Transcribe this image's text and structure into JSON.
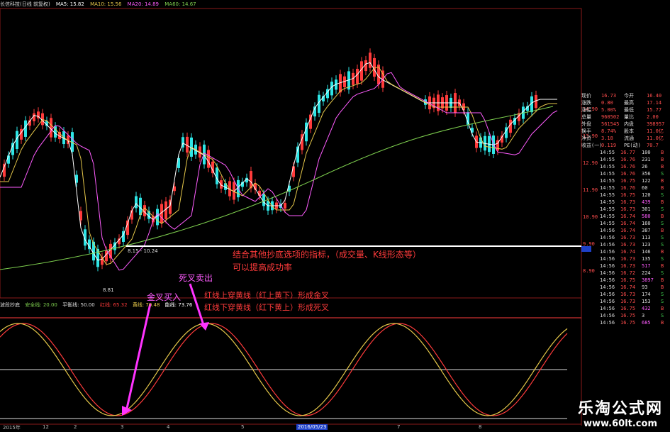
{
  "topbar": {
    "title": "长信科技(日线 前复权)",
    "ma5": "MA5: 15.82",
    "ma10": "MA10: 15.56",
    "ma20": "MA20: 14.89",
    "ma60": "MA60: 14.67"
  },
  "annotations": {
    "combine_line1": "结合其他抄底选项的指标，（成交量、K线形态等）",
    "combine_line2": "可以提高成功率",
    "golden_cross": "金叉买入",
    "dead_cross": "死叉卖出",
    "rule1": "红线上穿黄线（红上黄下）形成金叉",
    "rule2": "红线下穿黄线（红下黄上）形成死叉"
  },
  "price_labels": {
    "low": "8.81",
    "mid": "8.15 - 10.24"
  },
  "indicator_header": {
    "name": "波段抄底",
    "safe": "安全线: 20.00",
    "balance": "平衡线: 50.00",
    "red": "红线: 65.32",
    "yellow": "黄线: 70.48",
    "energy": "能线: 73.76"
  },
  "right_axis": [
    "14.90",
    "13.90",
    "12.90",
    "11.90",
    "10.90",
    "9.90",
    "8.90"
  ],
  "bottom_axis": {
    "year": "2015年",
    "m12": "12",
    "m2": "2",
    "m3": "3",
    "m4": "4",
    "m5": "5",
    "date": "2016/05/23",
    "m7": "7",
    "m8": "8"
  },
  "quote": [
    {
      "k": "现价",
      "v": "16.73",
      "k2": "今开",
      "v2": "16.40"
    },
    {
      "k": "涨跌",
      "v": "0.80",
      "k2": "最高",
      "v2": "17.14"
    },
    {
      "k": "涨幅",
      "v": "5.00%",
      "k2": "最低",
      "v2": "15.77"
    },
    {
      "k": "总量",
      "v": "960502",
      "k2": "量比",
      "v2": "2.00"
    },
    {
      "k": "外盘",
      "v": "561545",
      "k2": "内盘",
      "v2": "398957"
    },
    {
      "k": "换手",
      "v": "8.74%",
      "k2": "股本",
      "v2": "11.0亿"
    },
    {
      "k": "净资",
      "v": "3.18",
      "k2": "流通",
      "v2": "11.0亿"
    },
    {
      "k": "收益(一)",
      "v": "0.119",
      "k2": "PE(动)",
      "v2": "70.7"
    }
  ],
  "ticks": [
    {
      "t": "14:55",
      "p": "16.77",
      "q": "100",
      "s": "B"
    },
    {
      "t": "14:55",
      "p": "16.76",
      "q": "231",
      "s": "B"
    },
    {
      "t": "14:55",
      "p": "16.76",
      "q": "26",
      "s": "B"
    },
    {
      "t": "14:55",
      "p": "16.76",
      "q": "356",
      "s": "S"
    },
    {
      "t": "14:55",
      "p": "16.75",
      "q": "122",
      "s": "B"
    },
    {
      "t": "14:55",
      "p": "16.76",
      "q": "60",
      "s": "B"
    },
    {
      "t": "14:55",
      "p": "16.75",
      "q": "120",
      "s": "S"
    },
    {
      "t": "14:55",
      "p": "16.73",
      "q": "439",
      "s": "B"
    },
    {
      "t": "14:55",
      "p": "16.73",
      "q": "301",
      "s": "S"
    },
    {
      "t": "14:55",
      "p": "16.74",
      "q": "580",
      "s": "B"
    },
    {
      "t": "14:55",
      "p": "16.74",
      "q": "160",
      "s": "S"
    },
    {
      "t": "14:56",
      "p": "16.74",
      "q": "387",
      "s": "B"
    },
    {
      "t": "14:56",
      "p": "16.73",
      "q": "113",
      "s": "S"
    },
    {
      "t": "14:56",
      "p": "16.73",
      "q": "123",
      "s": "S"
    },
    {
      "t": "14:56",
      "p": "16.74",
      "q": "146",
      "s": "B"
    },
    {
      "t": "14:56",
      "p": "16.73",
      "q": "135",
      "s": "S"
    },
    {
      "t": "14:56",
      "p": "16.73",
      "q": "517",
      "s": "B"
    },
    {
      "t": "14:56",
      "p": "16.72",
      "q": "224",
      "s": "S"
    },
    {
      "t": "14:56",
      "p": "16.75",
      "q": "3897",
      "s": "B"
    },
    {
      "t": "14:56",
      "p": "16.74",
      "q": "93",
      "s": "B"
    },
    {
      "t": "14:56",
      "p": "16.73",
      "q": "174",
      "s": "S"
    },
    {
      "t": "14:56",
      "p": "16.73",
      "q": "153",
      "s": "S"
    },
    {
      "t": "14:56",
      "p": "16.75",
      "q": "432",
      "s": "B"
    },
    {
      "t": "14:56",
      "p": "16.75",
      "q": "3",
      "s": "S"
    },
    {
      "t": "14:56",
      "p": "16.75",
      "q": "685",
      "s": "B"
    }
  ],
  "watermark": {
    "cn": "乐淘公式网",
    "url": "www.60lt.com"
  },
  "colors": {
    "up": "#ff3b3b",
    "down": "#2ee6e6",
    "ma5": "#ffffff",
    "ma10": "#e6c84a",
    "ma20": "#ff5cff",
    "ma60": "#7fd14f",
    "arrow": "#ff33ff"
  }
}
